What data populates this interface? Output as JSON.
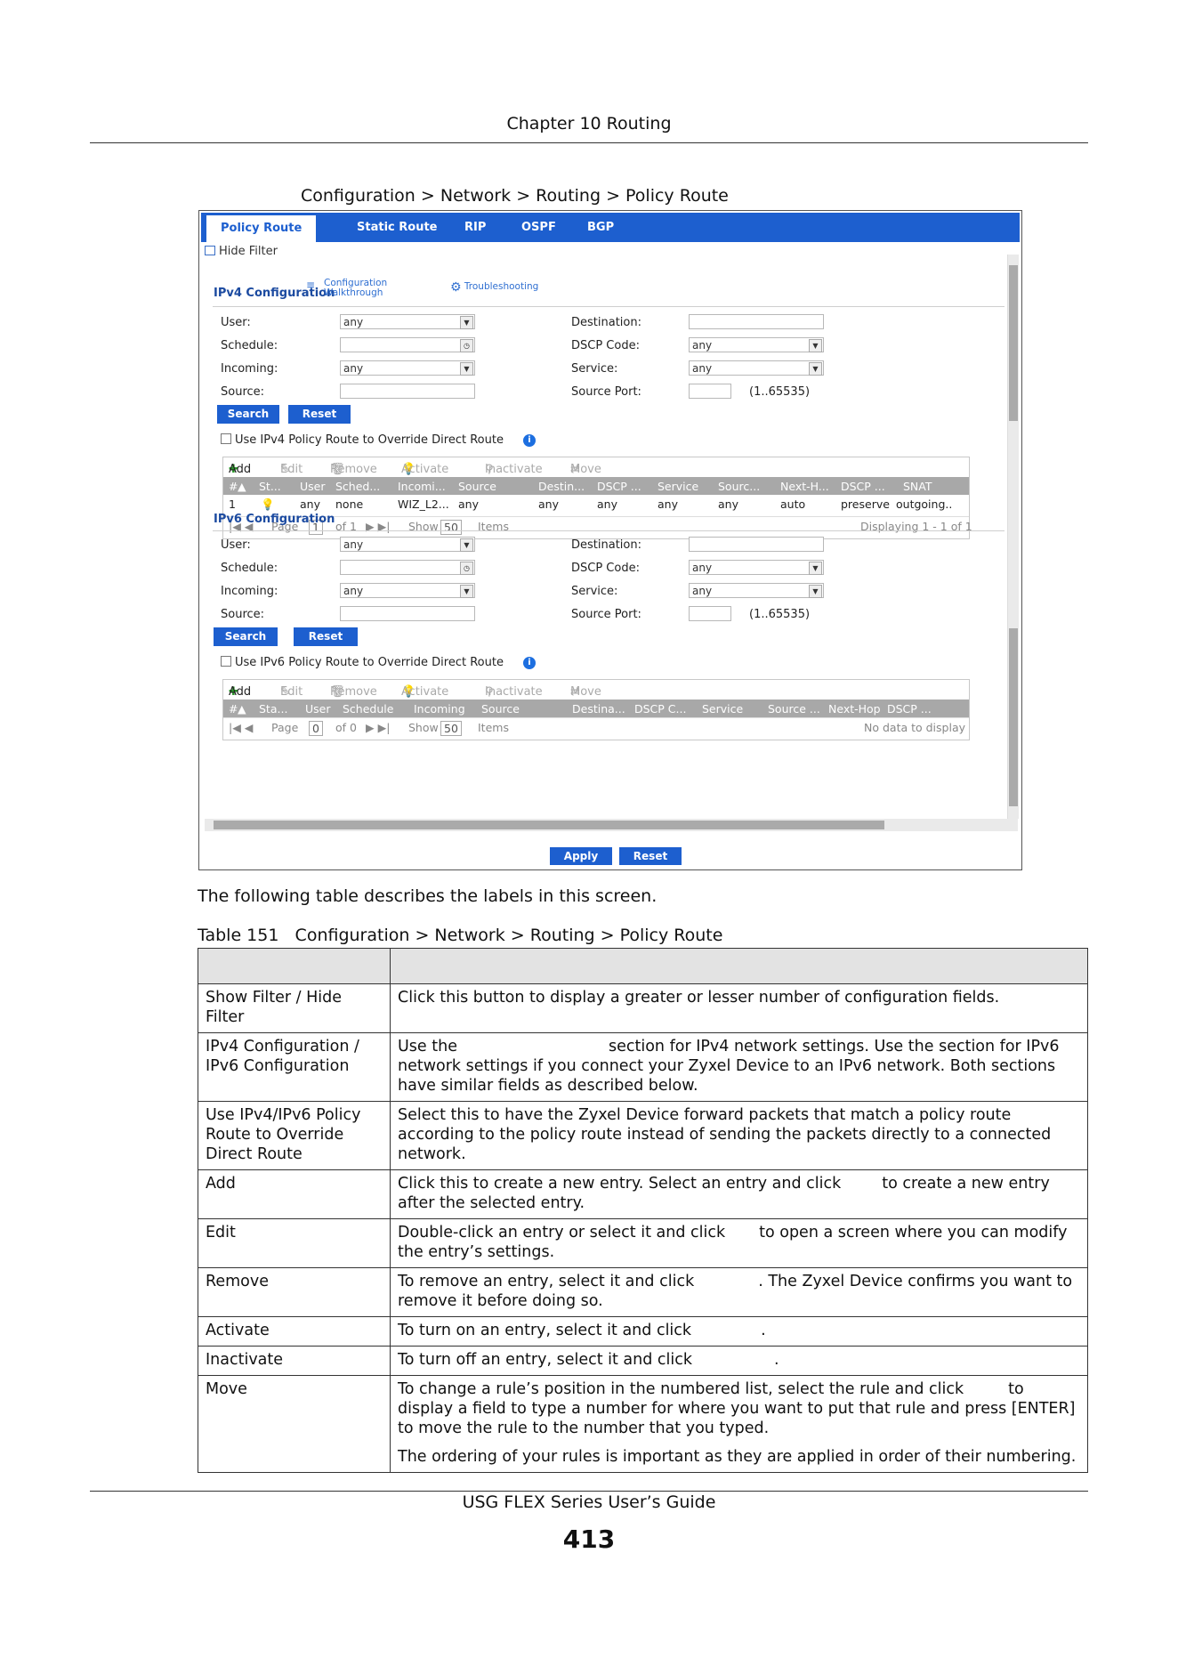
{
  "header": {
    "chapter": "Chapter 10 Routing"
  },
  "figure": {
    "caption": "Configuration > Network > Routing > Policy Route"
  },
  "screen": {
    "tabs": [
      {
        "label": "Policy Route",
        "active": true
      },
      {
        "label": "Static Route"
      },
      {
        "label": "RIP"
      },
      {
        "label": "OSPF"
      },
      {
        "label": "BGP"
      }
    ],
    "hide_filter": "Hide Filter",
    "ipv4": {
      "title": "IPv4 Configuration",
      "walkthrough": [
        "Configuration",
        "Walkthrough"
      ],
      "troubleshooting": "Troubleshooting",
      "user_label": "User:",
      "user_value": "any",
      "schedule_label": "Schedule:",
      "schedule_value": "",
      "incoming_label": "Incoming:",
      "incoming_value": "any",
      "source_label": "Source:",
      "source_value": "",
      "destination_label": "Destination:",
      "destination_value": "",
      "dscp_label": "DSCP Code:",
      "dscp_value": "any",
      "service_label": "Service:",
      "service_value": "any",
      "source_port_label": "Source Port:",
      "source_port_value": "",
      "source_port_range": "(1..65535)",
      "search": "Search",
      "reset": "Reset",
      "override": "Use IPv4 Policy Route to Override Direct Route",
      "toolbar": [
        "Add",
        "Edit",
        "Remove",
        "Activate",
        "Inactivate",
        "Move"
      ],
      "columns": [
        "#",
        "St...",
        "User",
        "Sched...",
        "Incomi...",
        "Source",
        "Destin...",
        "DSCP ...",
        "Service",
        "Sourc...",
        "Next-H...",
        "DSCP ...",
        "SNAT"
      ],
      "rows": [
        [
          "1",
          "",
          "any",
          "none",
          "WIZ_L2...",
          "any",
          "any",
          "any",
          "any",
          "any",
          "auto",
          "preserve",
          "outgoing.."
        ]
      ],
      "page_label": "Page",
      "page_value": "1",
      "of": "of 1",
      "show": "Show",
      "show_value": "50",
      "items": "Items",
      "displaying": "Displaying 1 - 1 of 1"
    },
    "ipv6": {
      "title": "IPv6 Configuration",
      "user_label": "User:",
      "user_value": "any",
      "schedule_label": "Schedule:",
      "schedule_value": "",
      "incoming_label": "Incoming:",
      "incoming_value": "any",
      "source_label": "Source:",
      "source_value": "",
      "destination_label": "Destination:",
      "destination_value": "",
      "dscp_label": "DSCP Code:",
      "dscp_value": "any",
      "service_label": "Service:",
      "service_value": "any",
      "source_port_label": "Source Port:",
      "source_port_value": "",
      "source_port_range": "(1..65535)",
      "search": "Search",
      "reset": "Reset",
      "override": "Use IPv6 Policy Route to Override Direct Route",
      "toolbar": [
        "Add",
        "Edit",
        "Remove",
        "Activate",
        "Inactivate",
        "Move"
      ],
      "columns": [
        "#",
        "Sta...",
        "User",
        "Schedule",
        "Incoming",
        "Source",
        "Destina...",
        "DSCP C...",
        "Service",
        "Source ...",
        "Next-Hop",
        "DSCP ..."
      ],
      "page_label": "Page",
      "page_value": "0",
      "of": "of 0",
      "show": "Show",
      "show_value": "50",
      "items": "Items",
      "no_data": "No data to display"
    },
    "apply": "Apply",
    "reset": "Reset"
  },
  "body": {
    "intro": "The following table describes the labels in this screen.",
    "table_caption": "Table 151   Configuration > Network > Routing > Policy Route",
    "rows": [
      {
        "label": "Show Filter / Hide Filter",
        "desc": [
          "Click this button to display a greater or lesser number of configuration fields."
        ]
      },
      {
        "label": "IPv4 Configuration / IPv6 Configuration",
        "desc": [
          "Use the",
          "section for IPv4 network settings. Use the",
          "section for IPv6 network settings if you connect your Zyxel Device to an IPv6 network. Both sections have similar fields as described below."
        ]
      },
      {
        "label": "Use IPv4/IPv6 Policy Route to Override Direct Route",
        "desc": [
          "Select this to have the Zyxel Device forward packets that match a policy route according to the policy route instead of sending the packets directly to a connected network."
        ]
      },
      {
        "label": "Add",
        "desc": [
          "Click this to create a new entry. Select an entry and click",
          "to create a new entry after the selected entry."
        ]
      },
      {
        "label": "Edit",
        "desc": [
          "Double-click an entry or select it and click",
          "to open a screen where you can modify the entry’s settings."
        ]
      },
      {
        "label": "Remove",
        "desc": [
          "To remove an entry, select it and click",
          ". The Zyxel Device confirms you want to remove it before doing so."
        ]
      },
      {
        "label": "Activate",
        "desc": [
          "To turn on an entry, select it and click",
          "."
        ]
      },
      {
        "label": "Inactivate",
        "desc": [
          "To turn off an entry, select it and click",
          "."
        ]
      },
      {
        "label": "Move",
        "desc": [
          "To change a rule’s position in the numbered list, select the rule and click",
          "to display a field to type a number for where you want to put that rule and press [ENTER] to move the rule to the number that you typed.",
          "The ordering of your rules is important as they are applied in order of their numbering."
        ]
      }
    ]
  },
  "footer": {
    "guide": "USG FLEX Series User’s Guide",
    "page_number": "413"
  }
}
